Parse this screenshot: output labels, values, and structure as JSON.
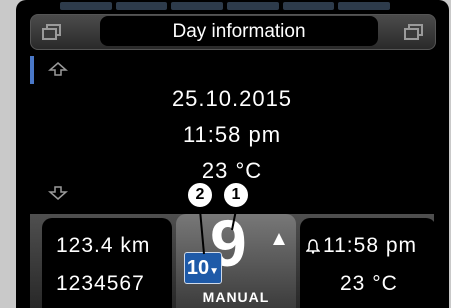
{
  "header": {
    "title": "Day information",
    "left_icon": "window-icon",
    "right_icon": "window-icon"
  },
  "info": {
    "date": "25.10.2015",
    "time": "11:58  pm",
    "temperature": "23 °C"
  },
  "status": {
    "left": {
      "distance": "123.4 km",
      "odometer": "1234567"
    },
    "center": {
      "current_gear": "9",
      "recommended_gear": "10",
      "mode": "MANUAL"
    },
    "right": {
      "clock": "11:58 pm",
      "outside_temp": "23 °C"
    }
  },
  "callouts": {
    "one": "1",
    "two": "2"
  },
  "colors": {
    "accent_blue": "#1e5aa8",
    "scroll_indicator": "#4a78c8",
    "background": "#000000",
    "text": "#ffffff"
  }
}
